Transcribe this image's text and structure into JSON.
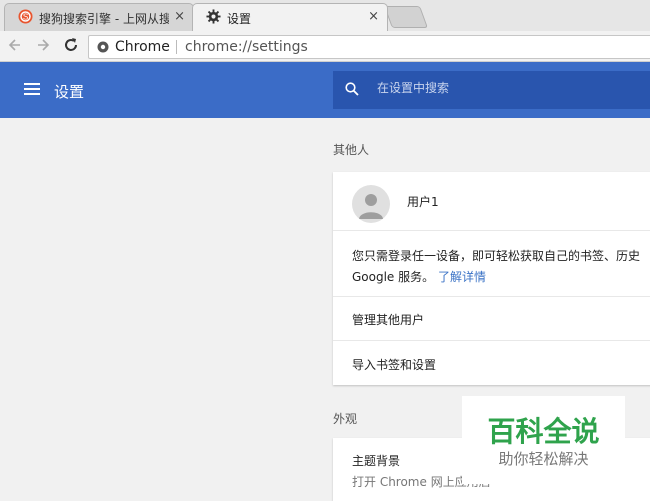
{
  "tabs": [
    {
      "title": "搜狗搜索引擎 - 上网从搜",
      "close": "×"
    },
    {
      "title": "设置",
      "close": "×"
    }
  ],
  "toolbar": {
    "omnibox_label": "Chrome",
    "url": "chrome://settings"
  },
  "header": {
    "title": "设置",
    "search_placeholder": "在设置中搜索"
  },
  "people": {
    "section_label": "其他人",
    "user_name": "用户1",
    "signin_text_line1": "您只需登录任一设备，即可轻松获取自己的书签、历史",
    "signin_text_line2": "Google 服务。",
    "learn_more": "了解详情",
    "manage_other_users": "管理其他用户",
    "import_bookmarks": "导入书签和设置"
  },
  "appearance": {
    "section_label": "外观",
    "theme_title": "主题背景",
    "theme_subtitle": "打开 Chrome 网上应用店"
  },
  "watermark": {
    "title": "百科全说",
    "subtitle": "助你轻松解决"
  },
  "colors": {
    "header_blue": "#3b6cc7",
    "search_blue": "#2955ae",
    "link_blue": "#3b73c6",
    "watermark_green": "#2fa34c",
    "sogou_red": "#e8552f"
  }
}
